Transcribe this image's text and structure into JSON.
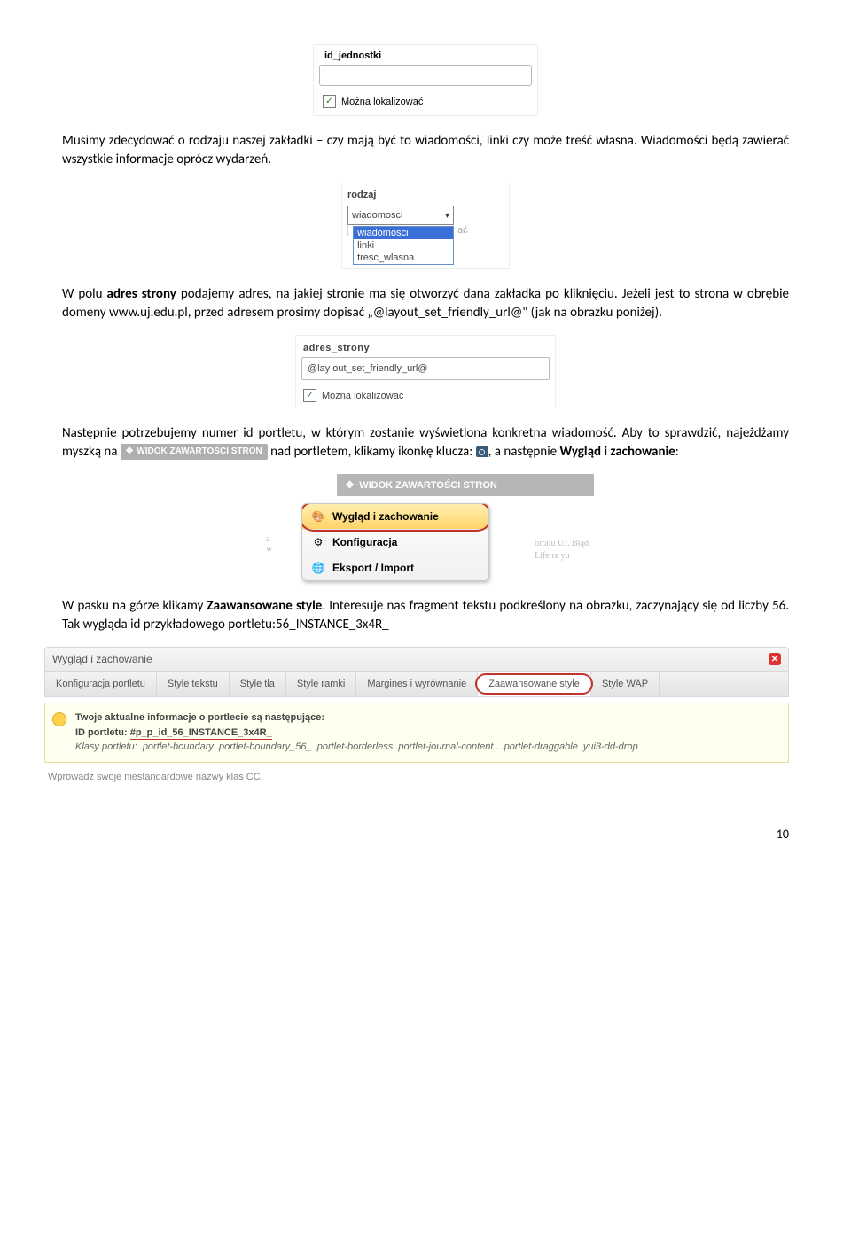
{
  "fig1": {
    "label": "id_jednostki",
    "checkbox_label": "Można lokalizować",
    "checked": true
  },
  "para1": "Musimy zdecydować o rodzaju naszej zakładki – czy mają być to wiadomości, linki czy może treść własna. Wiadomości będą zawierać wszystkie informacje oprócz wydarzeń.",
  "fig2": {
    "label": "rodzaj",
    "selected": "wiadomosci",
    "options": [
      "wiadomosci",
      "linki",
      "tresc_wlasna"
    ],
    "side_text": "ać"
  },
  "para2": {
    "t1": "W polu ",
    "b1": "adres strony",
    "t2": " podajemy adres, na jakiej stronie ma się otworzyć dana zakładka po kliknięciu. Jeżeli jest to strona w obrębie domeny www.uj.edu.pl, przed adresem prosimy dopisać „@layout_set_friendly_url@\" (jak na obrazku poniżej)."
  },
  "fig3": {
    "label": "adres_strony",
    "value": "@lay out_set_friendly_url@",
    "checkbox_label": "Można lokalizować",
    "checked": true
  },
  "para3": {
    "t1": "Następnie potrzebujemy numer id portletu, w którym zostanie wyświetlona konkretna wiadomość. Aby to sprawdzić, najeżdżamy myszką na ",
    "pill": "WIDOK ZAWARTOŚCI STRON",
    "t2": " nad portletem, klikamy ikonkę klucza: ",
    "t3": ", a następnie ",
    "b1": "Wygląd i zachowanie",
    "t4": ":"
  },
  "fig4": {
    "header": "WIDOK ZAWARTOŚCI STRON",
    "menu": [
      "Wygląd i zachowanie",
      "Konfiguracja",
      "Eksport / Import"
    ],
    "bg1": "ortalu UJ. Błąd",
    "bg2": "Life ra yu",
    "bg3": "a",
    "bg4": "w"
  },
  "para4": {
    "t1": "W pasku na górze klikamy ",
    "b1": "Zaawansowane style",
    "t2": ". Interesuje nas fragment tekstu podkreślony na obrazku, zaczynający się od liczby 56. Tak wygląda id przykładowego portletu:56_INSTANCE_3x4R_"
  },
  "fig5": {
    "title": "Wygląd i zachowanie",
    "tabs": [
      "Konfiguracja portletu",
      "Style tekstu",
      "Style tła",
      "Style ramki",
      "Margines i wyrównanie",
      "Zaawansowane style",
      "Style WAP"
    ],
    "selected_tab_index": 5,
    "info_l1": "Twoje aktualne informacje o portlecie są następujące:",
    "info_l2a": "ID portletu: ",
    "info_l2b": "#p_p_id_56_INSTANCE_3x4R_",
    "info_l3": "Klasy portletu: .portlet-boundary .portlet-boundary_56_ .portlet-borderless .portlet-journal-content . .portlet-draggable .yui3-dd-drop",
    "bottom": "Wprowadź swoje niestandardowe nazwy klas CC."
  },
  "page_number": "10"
}
